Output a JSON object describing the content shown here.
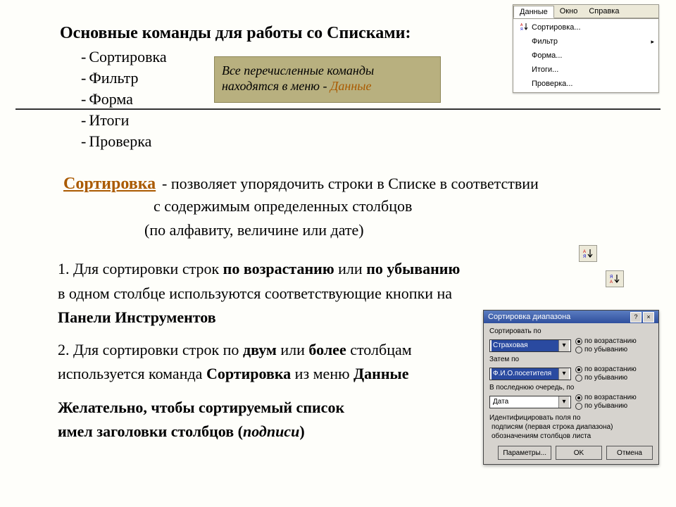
{
  "title": "Основные команды для работы со Списками:",
  "bullets": [
    "Сортировка",
    "Фильтр",
    "Форма",
    "Итоги",
    "Проверка"
  ],
  "note": {
    "line": "Все перечисленные команды находятся в меню - ",
    "highlight": "Данные"
  },
  "sort_heading": "Сортировка",
  "sort_desc1": " - позволяет упорядочить строки в Списке в соответствии",
  "sort_desc2": "с содержимым   определенных столбцов",
  "sort_desc3": "(по алфавиту, величине или дате)",
  "p1a_pre": "1. Для сортировки строк ",
  "p1a_b1": "по возрастанию",
  "p1a_mid": " или ",
  "p1a_b2": "по убыванию",
  "p1b": "в одном столбце используются соответствующие кнопки на",
  "p1c": " Панели Инструментов",
  "p2a_pre": "2. Для сортировки строк по ",
  "p2a_b1": "двум",
  "p2a_mid": " или ",
  "p2a_b2": "более",
  "p2a_post": " столбцам",
  "p2b_pre": "используется команда ",
  "p2b_b1": "Сортировка",
  "p2b_mid": " из меню ",
  "p2b_b2": "Данные",
  "p3a": "Желательно, чтобы сортируемый список",
  "p3b_pre": "имел заголовки столбцов (",
  "p3b_i": "подписи",
  "p3b_post": ")",
  "menu": {
    "bar": [
      "Данные",
      "Окно",
      "Справка"
    ],
    "items": [
      "Сортировка...",
      "Фильтр",
      "Форма...",
      "Итоги...",
      "Проверка..."
    ]
  },
  "dialog": {
    "title": "Сортировка диапазона",
    "lbl_sortby": "Сортировать по",
    "lbl_thenby": "Затем по",
    "lbl_lastby": "В последнюю очередь, по",
    "combo1": "Страховая",
    "combo2": "Ф.И.О.посетителя",
    "combo3": "Дата",
    "radio_asc": "по возрастанию",
    "radio_desc": "по убыванию",
    "ident_title": "Идентифицировать поля по",
    "ident_opt1": "подписям (первая строка диапазона)",
    "ident_opt2": "обозначениям столбцов листа",
    "btn_params": "Параметры...",
    "btn_ok": "OK",
    "btn_cancel": "Отмена"
  }
}
